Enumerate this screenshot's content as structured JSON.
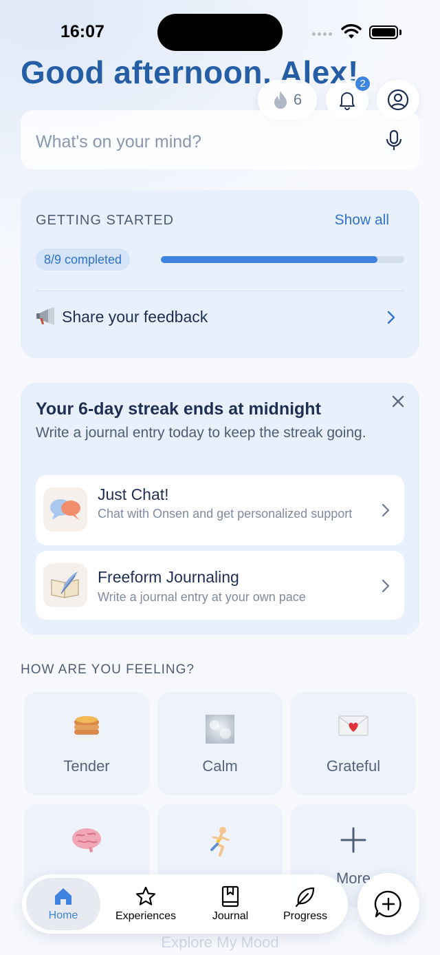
{
  "status_bar": {
    "time": "16:07"
  },
  "header": {
    "greeting": "Good afternoon, Alex!",
    "streak_count": "6",
    "notification_count": "2"
  },
  "search": {
    "placeholder": "What's on your mind?"
  },
  "getting_started": {
    "title": "GETTING STARTED",
    "show_all": "Show all",
    "progress_label": "8/9 completed",
    "progress_fraction": 0.889,
    "feedback_label": "Share your feedback"
  },
  "streak_card": {
    "title": "Your 6-day streak ends at midnight",
    "subtitle": "Write a journal entry today to keep the streak going.",
    "options": [
      {
        "title": "Just Chat!",
        "description": "Chat with Onsen and get personalized support"
      },
      {
        "title": "Freeform Journaling",
        "description": "Write a journal entry at your own pace"
      }
    ]
  },
  "feelings": {
    "heading": "HOW ARE YOU FEELING?",
    "moods": [
      {
        "label": "Tender",
        "icon": "pancakes-icon"
      },
      {
        "label": "Calm",
        "icon": "calm-texture-icon"
      },
      {
        "label": "Grateful",
        "icon": "love-letter-icon"
      },
      {
        "label": "",
        "icon": "brain-icon"
      },
      {
        "label": "",
        "icon": "runner-icon"
      },
      {
        "label": "More",
        "icon": "plus-icon"
      }
    ]
  },
  "tabbar": {
    "tabs": [
      {
        "label": "Home",
        "icon": "home-icon",
        "active": true
      },
      {
        "label": "Experiences",
        "icon": "star-icon"
      },
      {
        "label": "Journal",
        "icon": "journal-icon"
      },
      {
        "label": "Progress",
        "icon": "leaf-icon"
      }
    ]
  },
  "explore": {
    "label": "Explore My Mood"
  },
  "colors": {
    "accent": "#3d82dc",
    "greeting": "#265ea6",
    "card_bg": "#e8f0fb"
  }
}
